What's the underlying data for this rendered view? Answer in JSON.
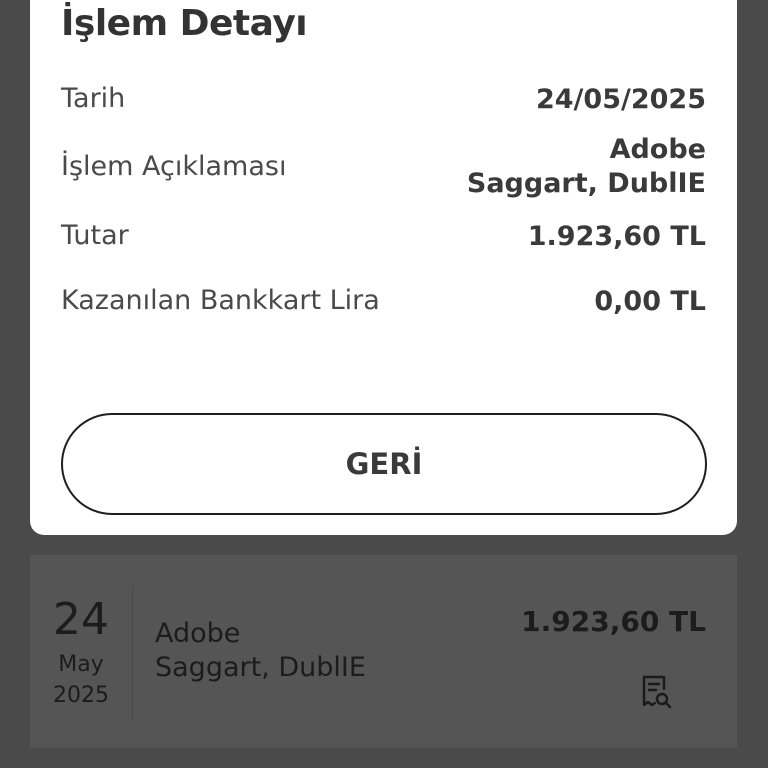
{
  "modal": {
    "title": "İşlem Detayı",
    "rows": [
      {
        "label": "Tarih",
        "value": "24/05/2025"
      },
      {
        "label": "İşlem Açıklaması",
        "value_line1": "Adobe",
        "value_line2": "Saggart, DublIE"
      },
      {
        "label": "Tutar",
        "value": "1.923,60 TL"
      },
      {
        "label": "Kazanılan Bankkart Lira",
        "value": "0,00 TL"
      }
    ],
    "back_label": "GERİ"
  },
  "transaction": {
    "day": "24",
    "month": "May",
    "year": "2025",
    "desc_line1": "Adobe",
    "desc_line2": "Saggart, DublIE",
    "amount": "1.923,60 TL",
    "icon": "receipt-search-icon"
  },
  "colors": {
    "overlay": "#4a4a4a",
    "modal_bg": "#ffffff",
    "card_bg": "#555555",
    "text_dark": "#333333"
  }
}
